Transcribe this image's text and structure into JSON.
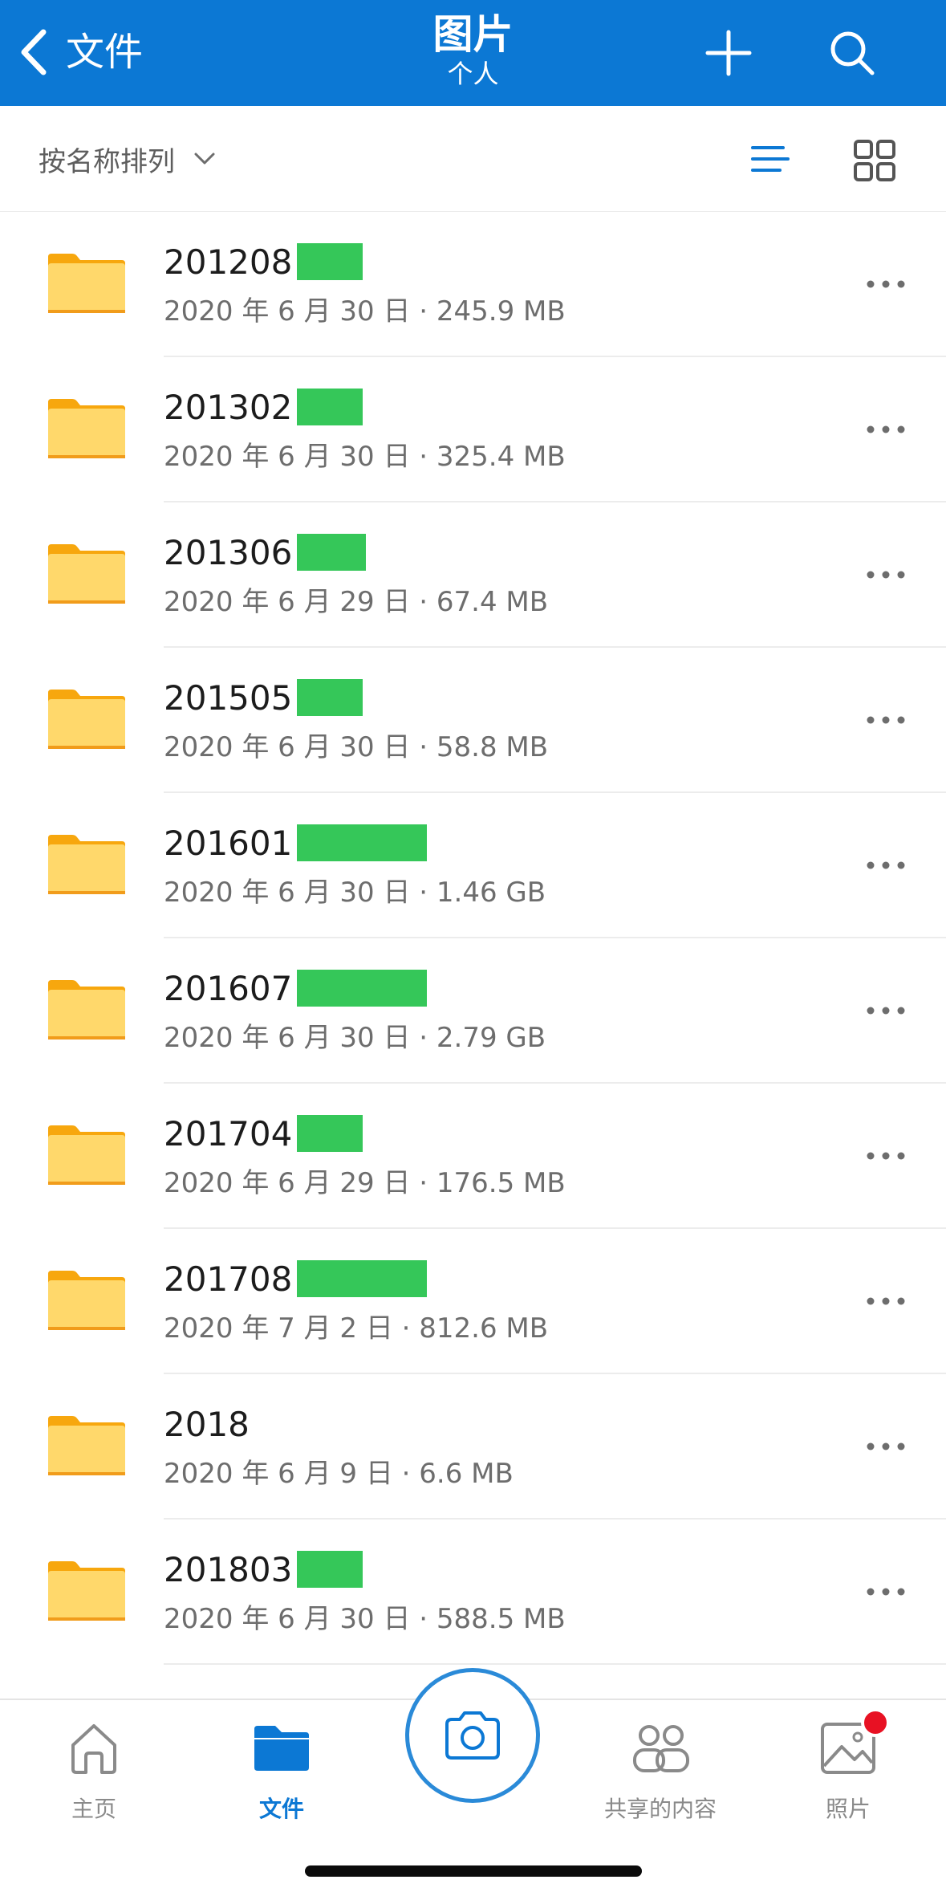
{
  "header": {
    "back_label": "文件",
    "title": "图片",
    "subtitle": "个人",
    "bg_color": "#0c78d4"
  },
  "sortbar": {
    "sort_label": "按名称排列",
    "active_view": "list"
  },
  "files": [
    {
      "name": "201208",
      "meta": "2020 年 6 月 30 日 · 245.9 MB",
      "redacted": true
    },
    {
      "name": "201302",
      "meta": "2020 年 6 月 30 日 · 325.4 MB",
      "redacted": true
    },
    {
      "name": "201306",
      "meta": "2020 年 6 月 29 日 · 67.4 MB",
      "redacted": true
    },
    {
      "name": "201505",
      "meta": "2020 年 6 月 30 日 · 58.8 MB",
      "redacted": true
    },
    {
      "name": "201601",
      "meta": "2020 年 6 月 30 日 · 1.46 GB",
      "redacted": true
    },
    {
      "name": "201607",
      "meta": "2020 年 6 月 30 日 · 2.79 GB",
      "redacted": true
    },
    {
      "name": "201704",
      "meta": "2020 年 6 月 29 日 · 176.5 MB",
      "redacted": true
    },
    {
      "name": "201708",
      "meta": "2020 年 7 月 2 日 · 812.6 MB",
      "redacted": true
    },
    {
      "name": "2018",
      "meta": "2020 年 6 月 9 日 · 6.6 MB",
      "redacted": false
    },
    {
      "name": "201803",
      "meta": "2020 年 6 月 30 日 · 588.5 MB",
      "redacted": true
    }
  ],
  "nav": {
    "home": "主页",
    "files": "文件",
    "shared": "共享的内容",
    "photos": "照片",
    "active": "files",
    "accent_color": "#0c78d4"
  }
}
